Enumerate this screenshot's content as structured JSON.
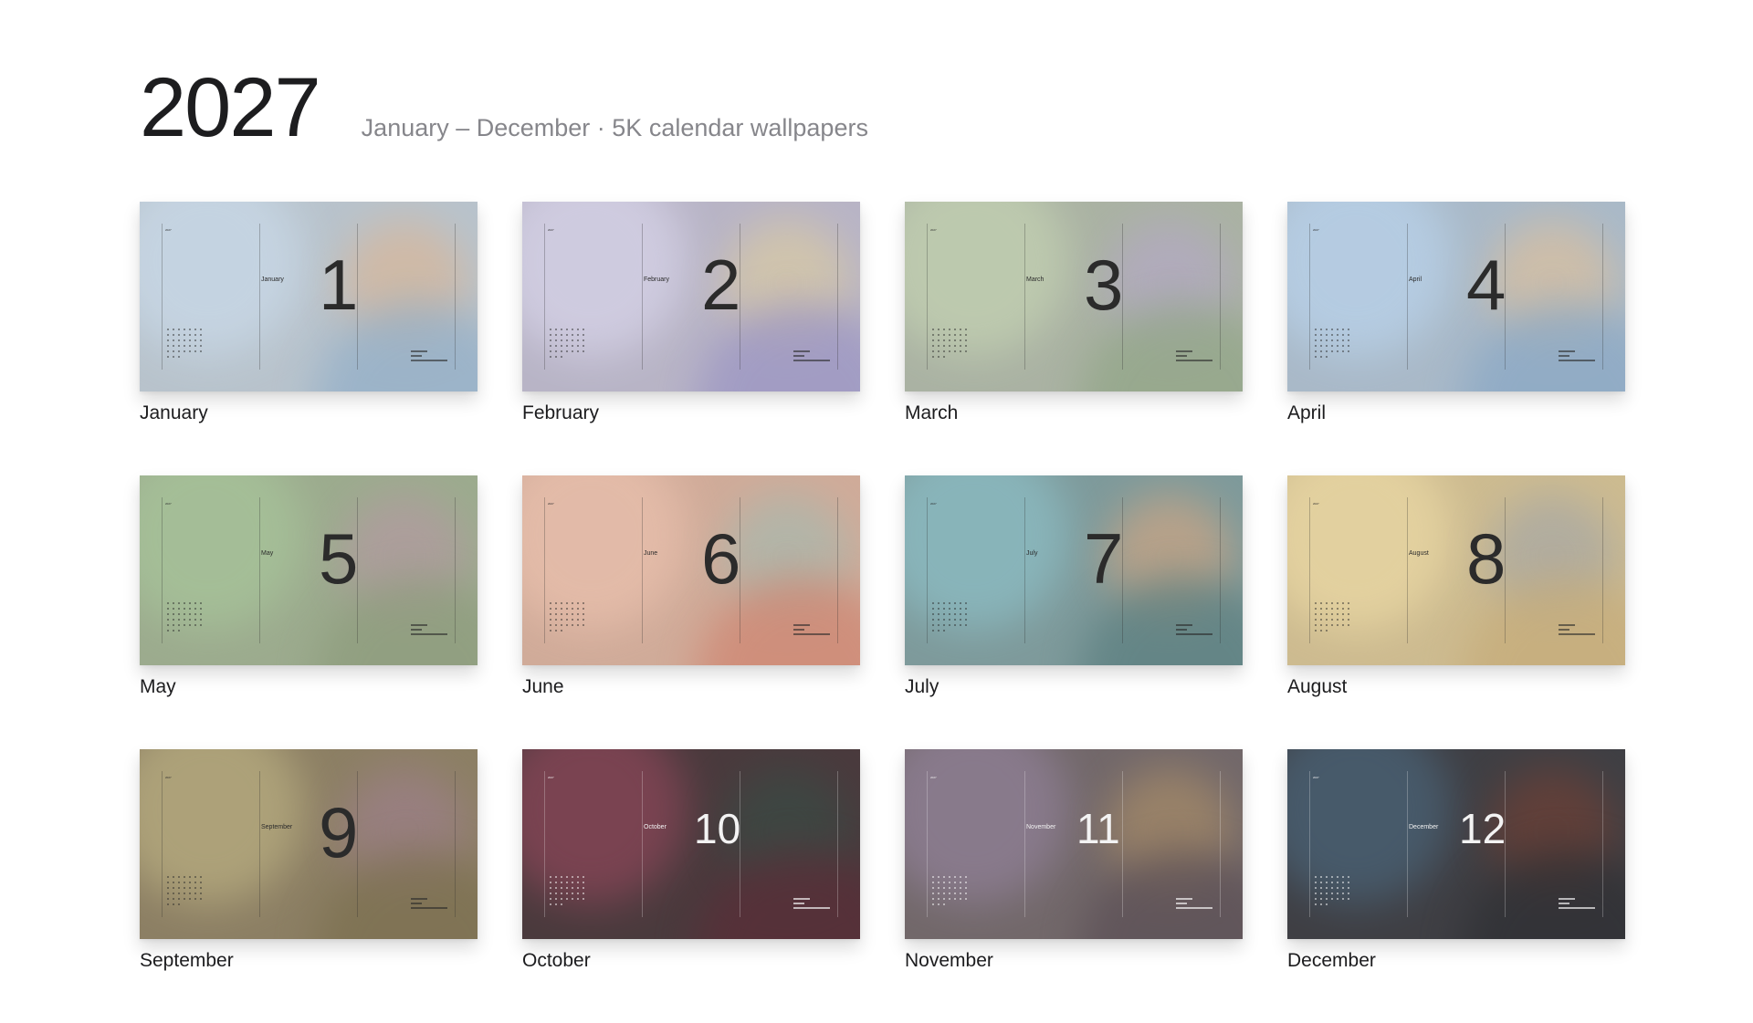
{
  "header": {
    "year": "2027",
    "subtitle": "January – December · 5K calendar wallpapers"
  },
  "wallpapers": [
    {
      "month": "January",
      "number": "1",
      "theme": "light",
      "base": "#b8c3cc",
      "c1": "#c9d9e8",
      "c2": "#d7b79a",
      "c3": "#93afc8"
    },
    {
      "month": "February",
      "number": "2",
      "theme": "light",
      "base": "#b8b4c6",
      "c1": "#d6d3e8",
      "c2": "#d8c9a4",
      "c3": "#9b95c3"
    },
    {
      "month": "March",
      "number": "3",
      "theme": "light",
      "base": "#aab2a3",
      "c1": "#c3d1b2",
      "c2": "#b3a9c3",
      "c3": "#92a688"
    },
    {
      "month": "April",
      "number": "4",
      "theme": "light",
      "base": "#a9b9c8",
      "c1": "#b9d2ea",
      "c2": "#d9bf9f",
      "c3": "#8aa8c5"
    },
    {
      "month": "May",
      "number": "5",
      "theme": "light",
      "base": "#9cab8e",
      "c1": "#a7c49a",
      "c2": "#b29aa0",
      "c3": "#8e9c7d"
    },
    {
      "month": "June",
      "number": "6",
      "theme": "light",
      "base": "#d0ab99",
      "c1": "#e9c0ad",
      "c2": "#a9b8ad",
      "c3": "#cf8672"
    },
    {
      "month": "July",
      "number": "7",
      "theme": "light",
      "base": "#7e9a9b",
      "c1": "#8cbdc4",
      "c2": "#c9a484",
      "c3": "#5c7f80"
    },
    {
      "month": "August",
      "number": "8",
      "theme": "light",
      "base": "#cdbb90",
      "c1": "#ead8a4",
      "c2": "#a8a8a4",
      "c3": "#c6ac7a"
    },
    {
      "month": "September",
      "number": "9",
      "theme": "light",
      "base": "#8c7f64",
      "c1": "#b8ad80",
      "c2": "#9c7f88",
      "c3": "#7c7050"
    },
    {
      "month": "October",
      "number": "10",
      "theme": "dark",
      "base": "#4a3a3d",
      "c1": "#8a4658",
      "c2": "#3a4a44",
      "c3": "#5a2e38"
    },
    {
      "month": "November",
      "number": "11",
      "theme": "dark",
      "base": "#72686a",
      "c1": "#908097",
      "c2": "#a58a68",
      "c3": "#5c5056"
    },
    {
      "month": "December",
      "number": "12",
      "theme": "dark",
      "base": "#3f3f44",
      "c1": "#4a6377",
      "c2": "#6c4036",
      "c3": "#2f3034"
    }
  ]
}
